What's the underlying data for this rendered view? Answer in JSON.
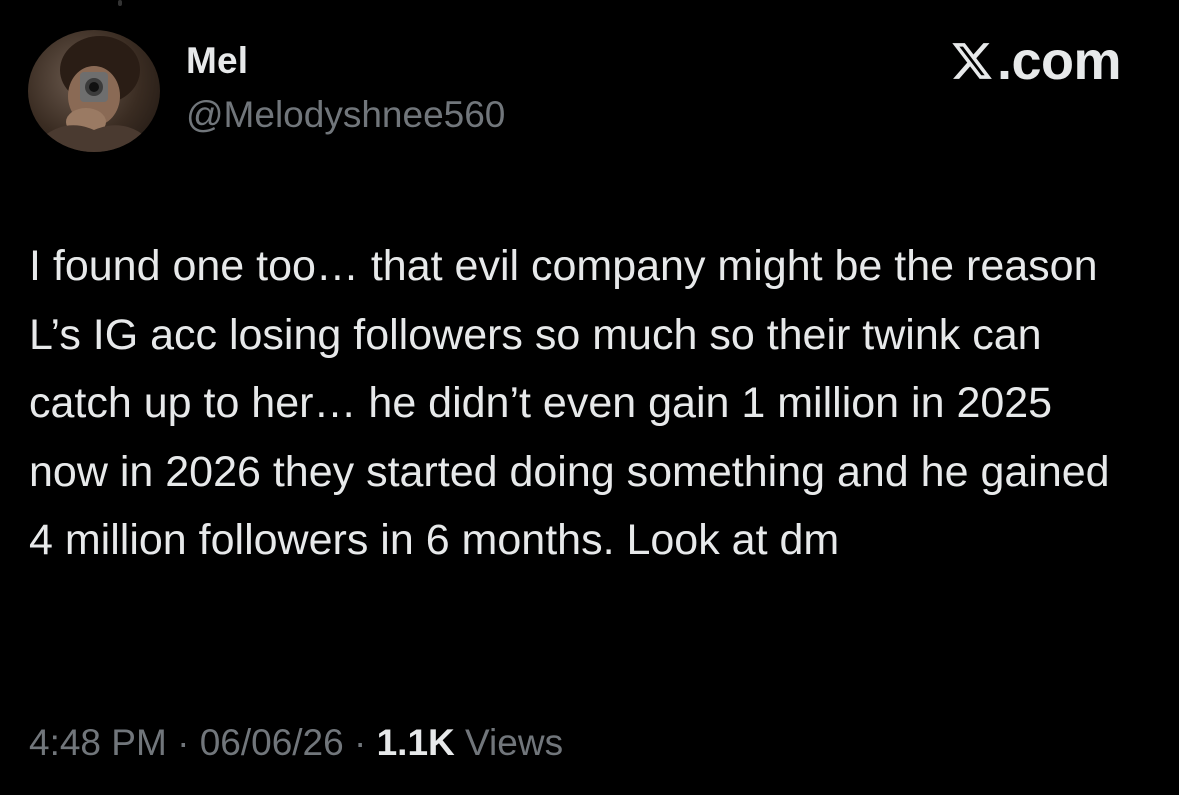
{
  "author": {
    "display_name": "Mel",
    "handle": "@Melodyshnee560"
  },
  "brand": {
    "text": ".com",
    "logo_icon": "x-logo-icon"
  },
  "tweet": {
    "text": "I found one too… that evil company might be the reason L’s IG acc losing followers so much so their twink can catch up to her… he didn’t even gain 1 million in 2025 now in 2026 they started doing something and he gained 4 million followers in 6 months. Look at dm"
  },
  "meta": {
    "time": "4:48 PM",
    "separator": " · ",
    "date": "06/06/26",
    "views_count": "1.1K",
    "views_label": " Views"
  },
  "colors": {
    "background": "#000000",
    "primary_text": "#e7e9ea",
    "secondary_text": "#71767b"
  }
}
